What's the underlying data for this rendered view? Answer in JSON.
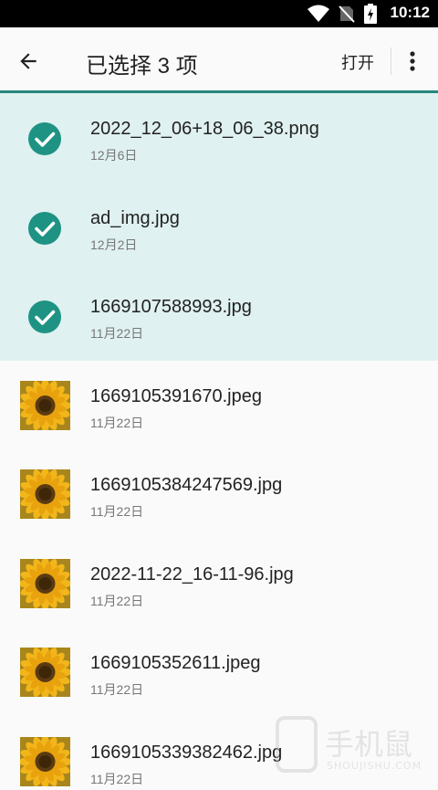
{
  "status_bar": {
    "time": "10:12"
  },
  "app_bar": {
    "title": "已选择 3 项",
    "open_label": "打开"
  },
  "files": [
    {
      "name": "2022_12_06+18_06_38.png",
      "date": "12月6日",
      "selected": true
    },
    {
      "name": "ad_img.jpg",
      "date": "12月2日",
      "selected": true
    },
    {
      "name": "1669107588993.jpg",
      "date": "11月22日",
      "selected": true
    },
    {
      "name": "1669105391670.jpeg",
      "date": "11月22日",
      "selected": false
    },
    {
      "name": "1669105384247569.jpg",
      "date": "11月22日",
      "selected": false
    },
    {
      "name": "2022-11-22_16-11-96.jpg",
      "date": "11月22日",
      "selected": false
    },
    {
      "name": "1669105352611.jpeg",
      "date": "11月22日",
      "selected": false
    },
    {
      "name": "1669105339382462.jpg",
      "date": "11月22日",
      "selected": false
    }
  ],
  "watermark": {
    "text": "手机鼠",
    "sub": "SHOUJISHU.COM"
  },
  "colors": {
    "accent": "#26867c",
    "selected_bg": "#dff1f0",
    "check": "#1e9384"
  },
  "icons": [
    "wifi-icon",
    "no-sim-icon",
    "battery-charging-icon",
    "back-arrow-icon",
    "more-vert-icon",
    "check-circle-icon",
    "sunflower-thumbnail"
  ]
}
